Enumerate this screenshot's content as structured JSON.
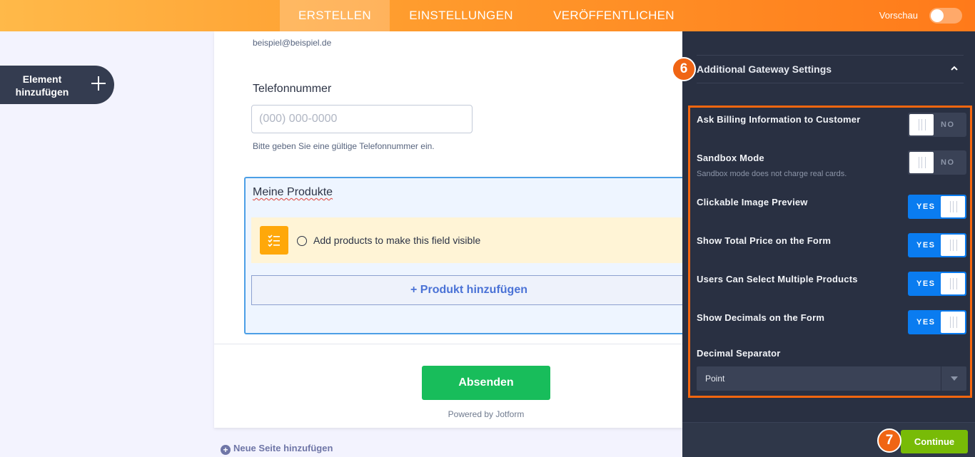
{
  "topbar": {
    "tabs": [
      "ERSTELLEN",
      "EINSTELLUNGEN",
      "VERÖFFENTLICHEN"
    ],
    "preview_label": "Vorschau"
  },
  "sidebar": {
    "add_element_line1": "Element",
    "add_element_line2": "hinzufügen"
  },
  "form": {
    "email_example": "beispiel@beispiel.de",
    "phone_label": "Telefonnummer",
    "phone_placeholder": "(000) 000-0000",
    "phone_hint": "Bitte geben Sie eine gültige Telefonnummer ein.",
    "products_title": "Meine Produkte",
    "products_notice": "Add products to make this field visible",
    "add_product_button": "+ Produkt hinzufügen",
    "submit_button": "Absenden",
    "powered_by": "Powered by Jotform",
    "new_page": "Neue Seite hinzufügen"
  },
  "panel": {
    "step_6": "6",
    "section_title": "Additional Gateway Settings",
    "settings": [
      {
        "label": "Ask Billing Information to Customer",
        "state": "NO"
      },
      {
        "label": "Sandbox Mode",
        "sub": "Sandbox mode does not charge real cards.",
        "state": "NO"
      },
      {
        "label": "Clickable Image Preview",
        "state": "YES"
      },
      {
        "label": "Show Total Price on the Form",
        "state": "YES"
      },
      {
        "label": "Users Can Select Multiple Products",
        "state": "YES"
      },
      {
        "label": "Show Decimals on the Form",
        "state": "YES"
      }
    ],
    "decimal_separator_label": "Decimal Separator",
    "decimal_separator_value": "Point",
    "step_7": "7",
    "continue_button": "Continue"
  },
  "colors": {
    "topbar_gradient_start": "#ffb949",
    "topbar_gradient_end": "#ff7a1a",
    "panel_bg": "#293042",
    "toggle_yes": "#0a7cf0",
    "highlight": "#f4660f",
    "submit_green": "#18bd5b",
    "continue_green": "#78bb07"
  }
}
